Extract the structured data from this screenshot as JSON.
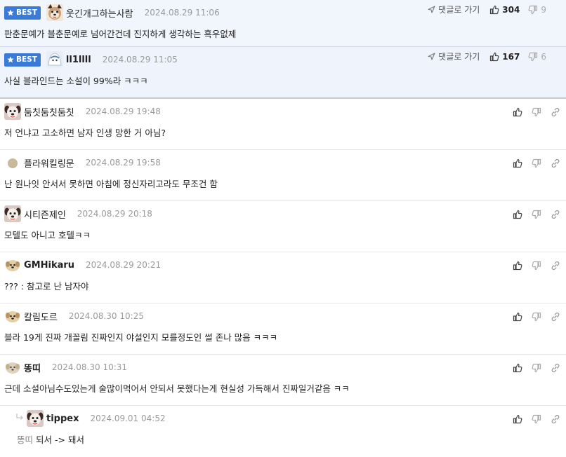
{
  "best_badge_label": "BEST",
  "goto_reply_label": "댓글로 가기",
  "best_comments": [
    {
      "nickname": "웃긴개그하는사람",
      "timestamp": "2024.08.29 11:06",
      "text": "판춘문예가 블춘문예로 넘어간건데 진지하게 생각하는 흑우없제",
      "likes": "304",
      "dislikes": "9"
    },
    {
      "nickname": "ll1llll",
      "timestamp": "2024.08.29 11:05",
      "text": "사실 블라인드는 소설이 99%라 ㅋㅋㅋ",
      "likes": "167",
      "dislikes": "6"
    }
  ],
  "comments": [
    {
      "nickname": "둠칫둠칫둠칫",
      "timestamp": "2024.08.29 19:48",
      "text": "저 언냐고 고소하면 남자 인생 망한 거 아님?"
    },
    {
      "nickname": "플라워킬링문",
      "timestamp": "2024.08.29 19:58",
      "text": "난 원나잇 안서서 못하면 아침에 정신자리고라도 무조건 함"
    },
    {
      "nickname": "시티즌제인",
      "timestamp": "2024.08.29 20:18",
      "text": "모텔도 아니고 호텔ㅋㅋ"
    },
    {
      "nickname": "GMHikaru",
      "timestamp": "2024.08.29 20:21",
      "text": "??? : 참고로 난 남자야"
    },
    {
      "nickname": "칼림도르",
      "timestamp": "2024.08.30 10:25",
      "text": "블라 19게 진짜 개꼴림 진짜인지 야설인지 모를정도인 썰 존나 많음 ㅋㅋㅋ"
    },
    {
      "nickname": "똥띠",
      "timestamp": "2024.08.30 10:31",
      "text": "근데 소설아님수도있는게 술많이먹어서 안되서 못했다는게 현실성 가득해서 진짜일거같음 ㅋㅋ"
    }
  ],
  "reply": {
    "nickname": "tippex",
    "timestamp": "2024.09.01 04:52",
    "mention": "똥띠",
    "text": "되서 -> 돼서"
  },
  "colors": {
    "badge": "#3b7bd8",
    "best_bg": "#eef3fc",
    "time": "#9a9a9a"
  },
  "icons": {
    "badge": "star-icon",
    "goto": "send-arrow-icon",
    "like": "thumbs-up-icon",
    "dislike": "thumbs-down-icon",
    "share": "link-icon",
    "reply": "reply-arrow-icon"
  }
}
